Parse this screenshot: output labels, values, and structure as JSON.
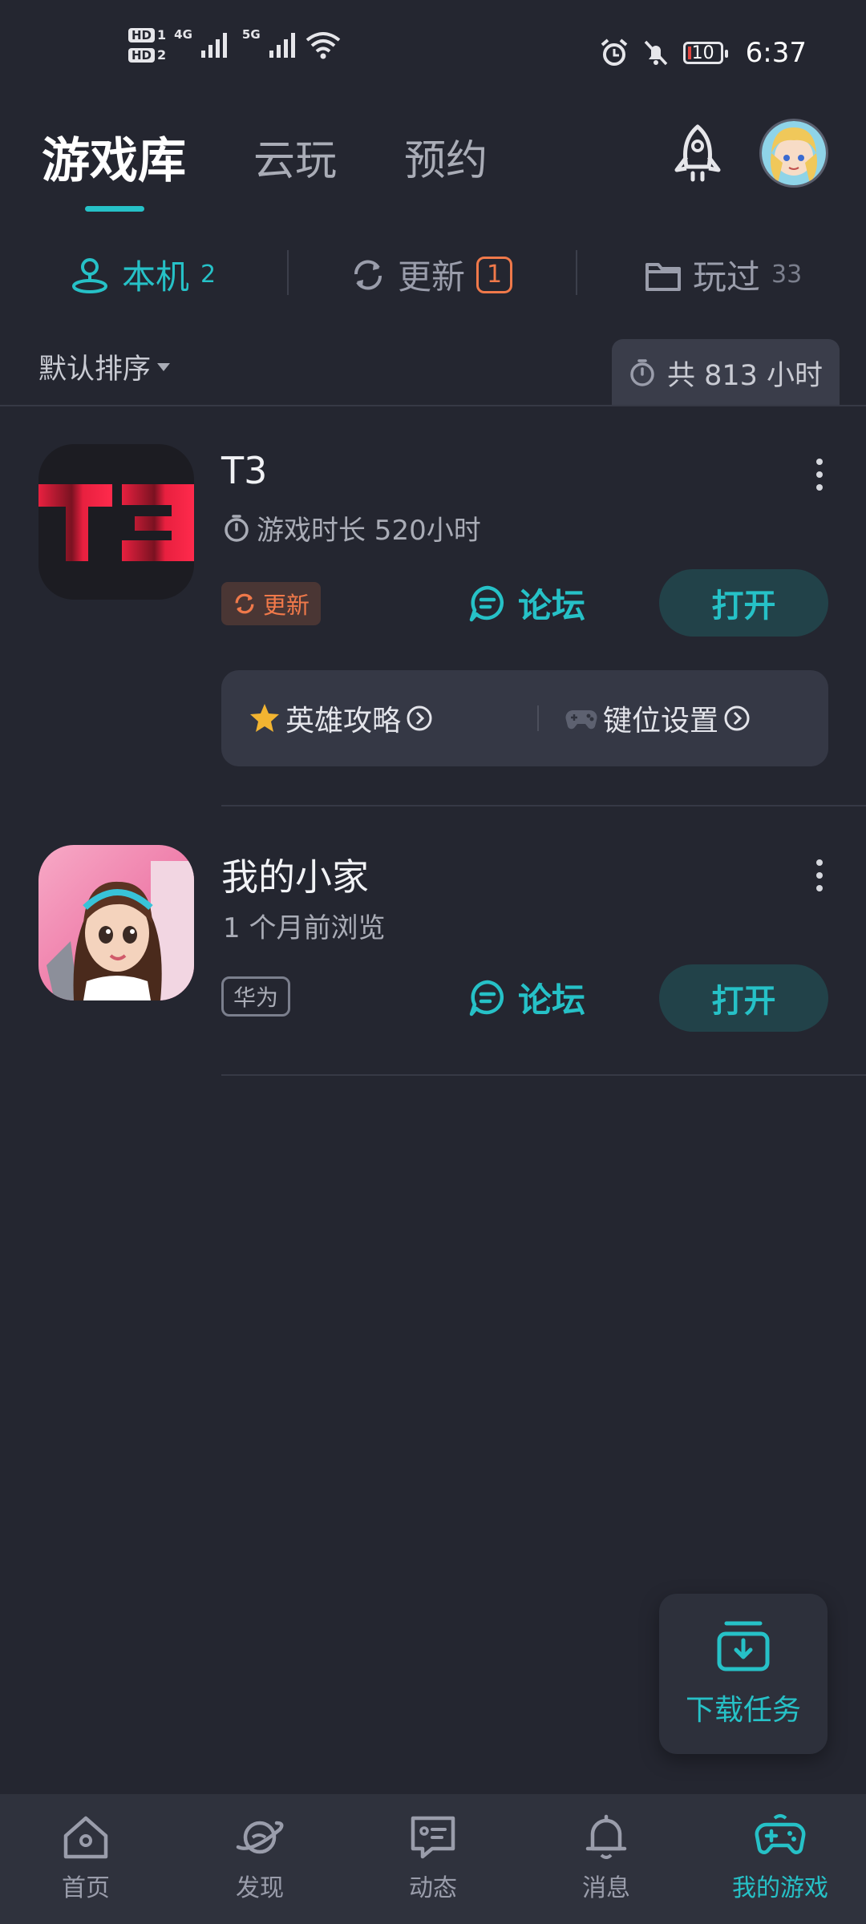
{
  "status_bar": {
    "hd1": "HD",
    "hd1_num": "1",
    "hd2": "HD",
    "hd2_num": "2",
    "net1": "4G",
    "net2": "5G",
    "battery": "10",
    "time": "6:37"
  },
  "header": {
    "tabs": [
      {
        "label": "游戏库",
        "active": true
      },
      {
        "label": "云玩",
        "active": false
      },
      {
        "label": "预约",
        "active": false
      }
    ],
    "rocket_icon": "rocket-icon",
    "avatar_icon": "user-avatar"
  },
  "sub_tabs": [
    {
      "label": "本机",
      "count": "2",
      "icon": "phone-user-icon",
      "active": true
    },
    {
      "label": "更新",
      "count": "1",
      "icon": "refresh-icon",
      "active": false
    },
    {
      "label": "玩过",
      "count": "33",
      "icon": "folder-icon",
      "active": false
    }
  ],
  "sort": {
    "label": "默认排序"
  },
  "total_time": "共 813 小时",
  "games": [
    {
      "title": "T3",
      "subtitle": "游戏时长 520小时",
      "badge": "更新",
      "forum": "论坛",
      "open": "打开",
      "tools": [
        {
          "label": "英雄攻略",
          "icon": "star-icon"
        },
        {
          "label": "键位设置",
          "icon": "gamepad-icon"
        }
      ]
    },
    {
      "title": "我的小家",
      "subtitle": "1 个月前浏览",
      "badge": "华为",
      "forum": "论坛",
      "open": "打开"
    }
  ],
  "download_task": "下载任务",
  "bottom_nav": [
    {
      "label": "首页",
      "icon": "home-icon",
      "active": false
    },
    {
      "label": "发现",
      "icon": "planet-icon",
      "active": false
    },
    {
      "label": "动态",
      "icon": "chat-card-icon",
      "active": false
    },
    {
      "label": "消息",
      "icon": "bell-icon",
      "active": false
    },
    {
      "label": "我的游戏",
      "icon": "gamepad-icon",
      "active": true
    }
  ],
  "colors": {
    "background": "#242630",
    "accent": "#26c1c7",
    "update_orange": "#f0794a",
    "card": "#353845"
  }
}
